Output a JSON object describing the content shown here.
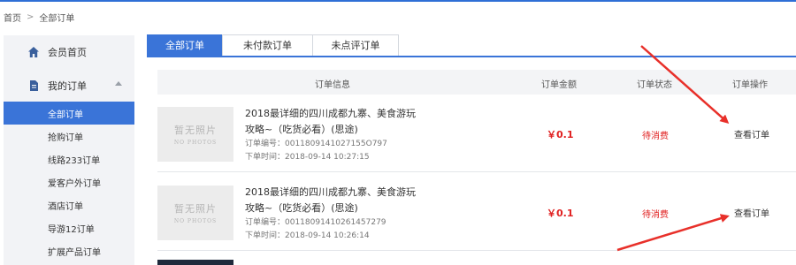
{
  "breadcrumb": {
    "home": "首页",
    "separator": ">",
    "current": "全部订单"
  },
  "sidebar": {
    "member_home": {
      "label": "会员首页",
      "icon": "home-icon"
    },
    "my_orders": {
      "label": "我的订单",
      "icon": "document-icon"
    },
    "items": [
      {
        "label": "全部订单",
        "active": true
      },
      {
        "label": "抢购订单",
        "active": false
      },
      {
        "label": "线路233订单",
        "active": false
      },
      {
        "label": "爱客户外订单",
        "active": false
      },
      {
        "label": "酒店订单",
        "active": false
      },
      {
        "label": "导游12订单",
        "active": false
      },
      {
        "label": "扩展产品订单",
        "active": false
      }
    ]
  },
  "tabs": [
    {
      "label": "全部订单",
      "active": true
    },
    {
      "label": "未付款订单",
      "active": false
    },
    {
      "label": "未点评订单",
      "active": false
    }
  ],
  "table": {
    "headers": {
      "info": "订单信息",
      "amount": "订单金额",
      "status": "订单状态",
      "action": "订单操作"
    },
    "rows": [
      {
        "thumb_text": "暂无照片",
        "thumb_subtext": "NO PHOTOS",
        "title_line1": "2018最详细的四川成都九寨、美食游玩",
        "title_line2": "攻略~（吃货必看）(思途)",
        "order_no": "订单编号：0011809141027155O797",
        "order_time": "下单时间：2018-09-14 10:27:15",
        "amount": "￥0.1",
        "status": "待消费",
        "action": "查看订单"
      },
      {
        "thumb_text": "暂无照片",
        "thumb_subtext": "NO PHOTOS",
        "title_line1": "2018最详细的四川成都九寨、美食游玩",
        "title_line2": "攻略~（吃货必看）(思途)",
        "order_no": "订单编号：00118091410261457279",
        "order_time": "下单时间：2018-09-14 10:26:14",
        "amount": "￥0.1",
        "status": "待消费",
        "action": "查看订单"
      }
    ]
  },
  "colors": {
    "accent": "#3a74d8",
    "price": "#e02020",
    "annotation_arrow": "#e8302a"
  }
}
